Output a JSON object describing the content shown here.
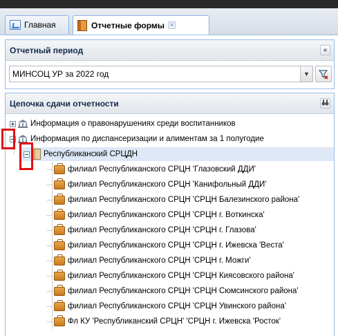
{
  "tabs": [
    {
      "label": "Главная",
      "icon": "home-icon"
    },
    {
      "label": "Отчетные формы",
      "icon": "reports-icon",
      "active": true
    }
  ],
  "period_panel": {
    "title": "Отчетный период",
    "collapse_glyph": "«",
    "selected_value": "МИНСОЦ УР за 2022 год"
  },
  "chain_panel": {
    "title": "Цепочка сдачи отчетности",
    "search_icon": "binoculars-icon",
    "tree": [
      {
        "label": "Информация о правонарушениях среди воспитанников",
        "level": 0,
        "expanded": false,
        "icon": "bank-icon"
      },
      {
        "label": "Информация по диспансеризации и алиментам за 1 полугодие",
        "level": 0,
        "expanded": true,
        "icon": "bank-icon"
      },
      {
        "label": "Республиканский СРЦДН",
        "level": 1,
        "expanded": true,
        "icon": "building-icon",
        "selected": true
      },
      {
        "label": "филиал Республиканского СРЦН 'Глазовский ДДИ'",
        "level": 2,
        "icon": "briefcase-icon"
      },
      {
        "label": "филиал Республиканского СРЦН 'Канифольный ДДИ'",
        "level": 2,
        "icon": "briefcase-icon"
      },
      {
        "label": "филиал Республиканского СРЦН 'СРЦН Балезинского района'",
        "level": 2,
        "icon": "briefcase-icon"
      },
      {
        "label": "филиал Республиканского СРЦН 'СРЦН г. Воткинска'",
        "level": 2,
        "icon": "briefcase-icon"
      },
      {
        "label": "филиал Республиканского СРЦН 'СРЦН г. Глазова'",
        "level": 2,
        "icon": "briefcase-icon"
      },
      {
        "label": "филиал Республиканского СРЦН 'СРЦН г. Ижевска 'Веста'",
        "level": 2,
        "icon": "briefcase-icon"
      },
      {
        "label": "филиал Республиканского СРЦН 'СРЦН г. Можги'",
        "level": 2,
        "icon": "briefcase-icon"
      },
      {
        "label": "филиал Республиканского СРЦН 'СРЦН Киясовского района'",
        "level": 2,
        "icon": "briefcase-icon"
      },
      {
        "label": "филиал Республиканского СРЦН 'СРЦН Сюмсинского района'",
        "level": 2,
        "icon": "briefcase-icon"
      },
      {
        "label": "филиал Республиканского СРЦН 'СРЦН Увинского района'",
        "level": 2,
        "icon": "briefcase-icon"
      },
      {
        "label": "Фл КУ 'Республиканский СРЦН' 'СРЦН г. Ижевска 'Росток'",
        "level": 2,
        "icon": "briefcase-icon"
      }
    ]
  },
  "colors": {
    "highlight": "#e01010",
    "selection": "#dfe8f6",
    "border": "#99bbe8"
  }
}
